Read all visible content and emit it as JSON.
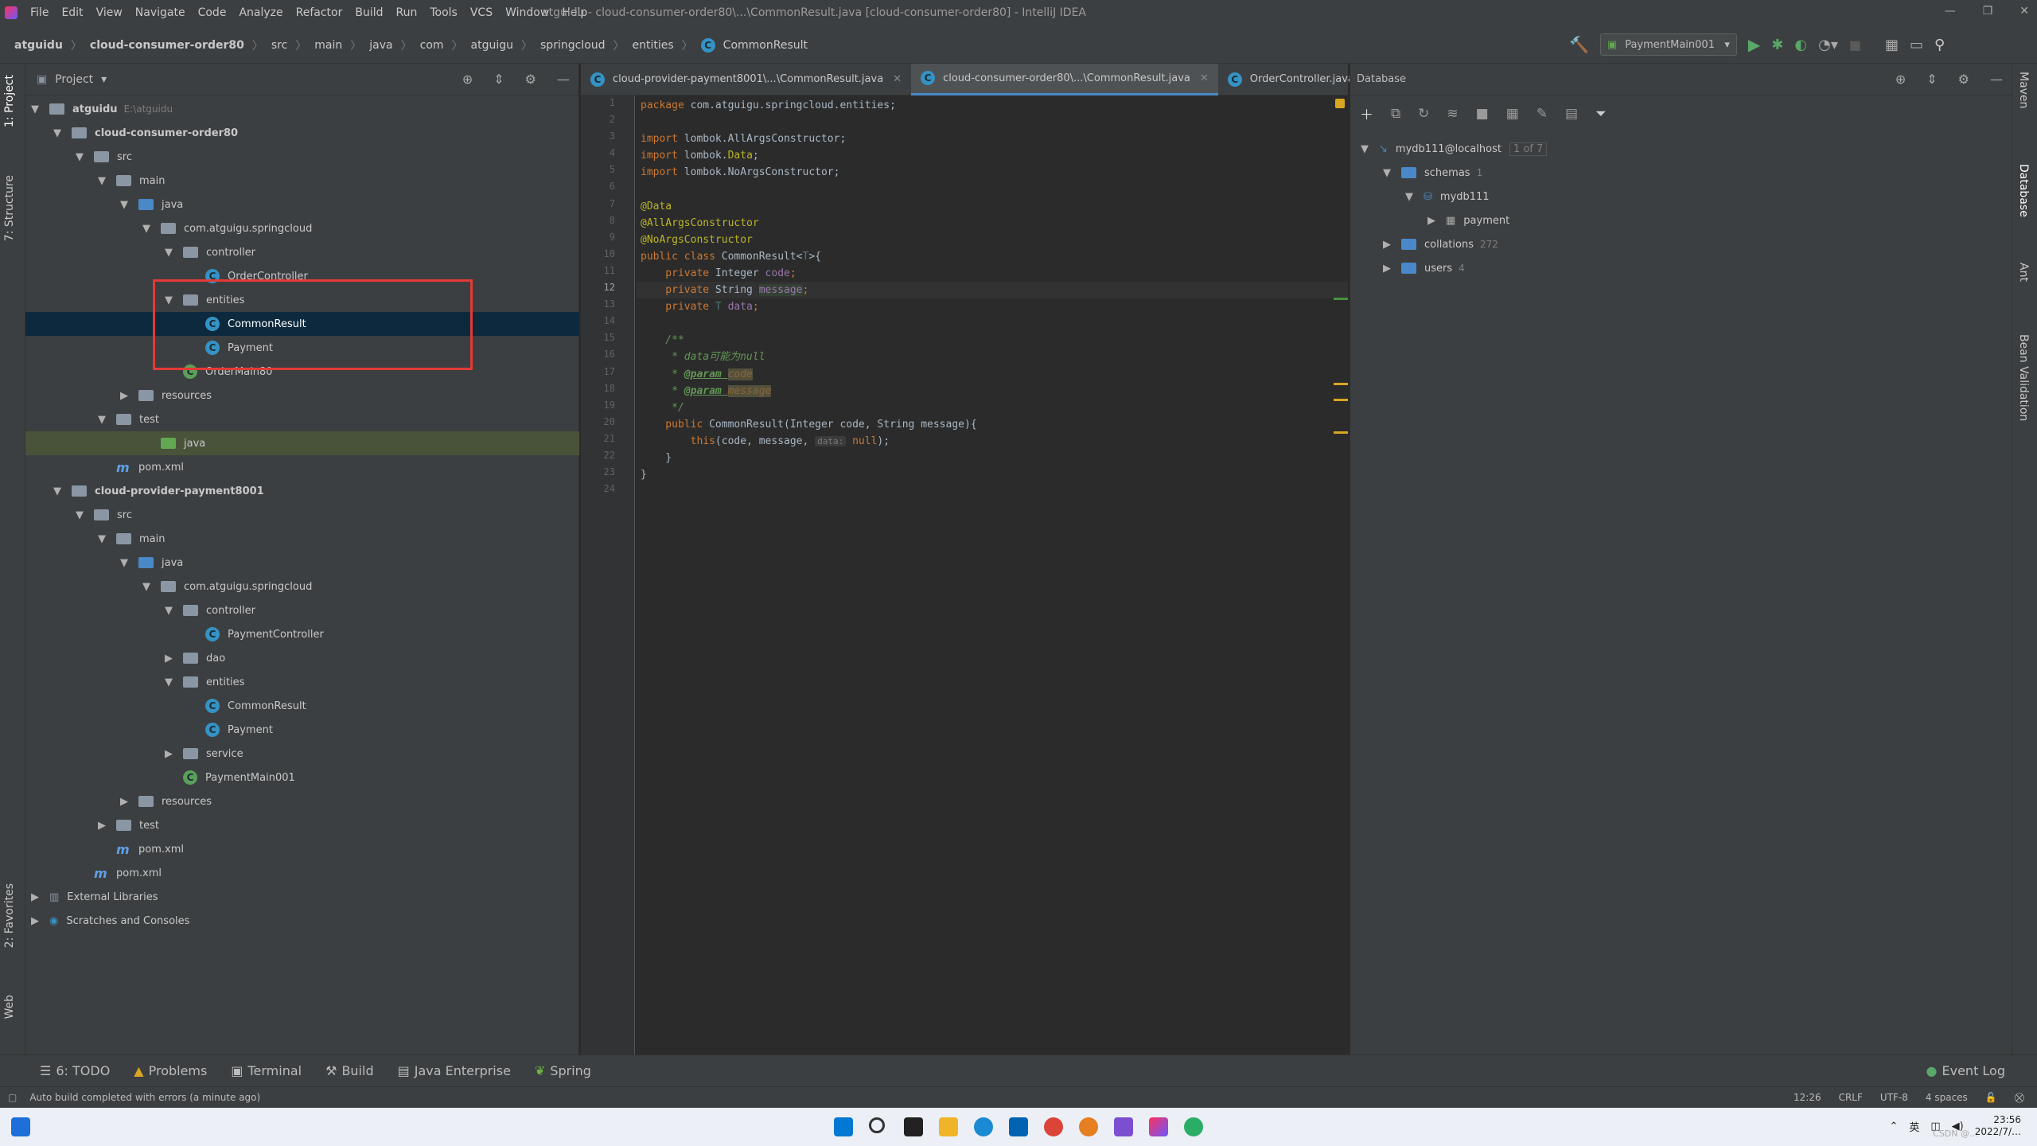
{
  "window": {
    "menu": [
      "File",
      "Edit",
      "View",
      "Navigate",
      "Code",
      "Analyze",
      "Refactor",
      "Build",
      "Run",
      "Tools",
      "VCS",
      "Window",
      "Help"
    ],
    "title": "atguidu - cloud-consumer-order80\\...\\CommonResult.java [cloud-consumer-order80] - IntelliJ IDEA"
  },
  "breadcrumbs": [
    "atguidu",
    "cloud-consumer-order80",
    "src",
    "main",
    "java",
    "com",
    "atguigu",
    "springcloud",
    "entities",
    "CommonResult"
  ],
  "run_config": "PaymentMain001",
  "left_tabs": [
    "1: Project",
    "7: Structure",
    "2: Favorites",
    "Web"
  ],
  "right_tabs": [
    "Maven",
    "Database",
    "Ant",
    "Bean Validation"
  ],
  "project": {
    "header": "Project",
    "items": [
      {
        "label": "atguidu",
        "extra": "E:\\atguidu"
      },
      {
        "label": "cloud-consumer-order80"
      },
      {
        "label": "src"
      },
      {
        "label": "main"
      },
      {
        "label": "java"
      },
      {
        "label": "com.atguigu.springcloud"
      },
      {
        "label": "controller"
      },
      {
        "label": "OrderController"
      },
      {
        "label": "entities"
      },
      {
        "label": "CommonResult"
      },
      {
        "label": "Payment"
      },
      {
        "label": "OrderMain80"
      },
      {
        "label": "resources"
      },
      {
        "label": "test"
      },
      {
        "label": "java"
      },
      {
        "label": "pom.xml"
      },
      {
        "label": "cloud-provider-payment8001"
      },
      {
        "label": "src"
      },
      {
        "label": "main"
      },
      {
        "label": "java"
      },
      {
        "label": "com.atguigu.springcloud"
      },
      {
        "label": "controller"
      },
      {
        "label": "PaymentController"
      },
      {
        "label": "dao"
      },
      {
        "label": "entities"
      },
      {
        "label": "CommonResult"
      },
      {
        "label": "Payment"
      },
      {
        "label": "service"
      },
      {
        "label": "PaymentMain001"
      },
      {
        "label": "resources"
      },
      {
        "label": "test"
      },
      {
        "label": "pom.xml"
      },
      {
        "label": "pom.xml"
      },
      {
        "label": "External Libraries"
      },
      {
        "label": "Scratches and Consoles"
      }
    ]
  },
  "editor": {
    "tabs": [
      {
        "label": "cloud-provider-payment8001\\...\\CommonResult.java"
      },
      {
        "label": "cloud-consumer-order80\\...\\CommonResult.java"
      },
      {
        "label": "OrderController.java"
      }
    ],
    "line_numbers": [
      "1",
      "2",
      "3",
      "4",
      "5",
      "6",
      "7",
      "8",
      "9",
      "10",
      "11",
      "12",
      "13",
      "14",
      "15",
      "16",
      "17",
      "18",
      "19",
      "20",
      "21",
      "22",
      "23",
      "24"
    ],
    "code": {
      "l1a": "package ",
      "l1b": "com.atguigu.springcloud.entities;",
      "l3a": "import ",
      "l3b": "lombok.AllArgsConstructor;",
      "l4a": "import ",
      "l4b": "lombok.",
      "l4c": "Data",
      ";": ";",
      "l5a": "import ",
      "l5b": "lombok.NoArgsConstructor;",
      "l7": "@Data",
      "l8": "@AllArgsConstructor",
      "l9": "@NoArgsConstructor",
      "l10a": "public class ",
      "l10b": "CommonResult<",
      "l10c": "T",
      "l10d": ">{",
      "l11a": "    private ",
      "l11b": "Integer ",
      "l11c": "code",
      "l12a": "    private ",
      "l12b": "String ",
      "l12c": "message",
      "l13a": "    private ",
      "l13b": "T ",
      "l13c": "data",
      "l15": "    /**",
      "l16": "     * data可能为null",
      "l17a": "     * ",
      "l17b": "@param ",
      "l17c": "code",
      "l18a": "     * ",
      "l18b": "@param ",
      "l18c": "message",
      "l19": "     */",
      "l20a": "    public ",
      "l20b": "CommonResult(Integer code, String message){",
      "l21a": "        this",
      "l21b": "(code, message, ",
      "l21c": "data:",
      "l21d": " null",
      ");": ");",
      "l22": "    }",
      "l23": "}"
    }
  },
  "database": {
    "header": "Database",
    "connection": "mydb111@localhost",
    "connection_badge": "1 of 7",
    "schemas_label": "schemas",
    "schemas_count": "1",
    "schema_name": "mydb111",
    "table_name": "payment",
    "collations_label": "collations",
    "collations_count": "272",
    "users_label": "users",
    "users_count": "4"
  },
  "bottom_tools": [
    "6: TODO",
    "Problems",
    "Terminal",
    "Build",
    "Java Enterprise",
    "Spring"
  ],
  "event_log": "Event Log",
  "status": {
    "message": "Auto build completed with errors (a minute ago)",
    "position": "12:26",
    "line_sep": "CRLF",
    "encoding": "UTF-8",
    "indent": "4 spaces"
  },
  "taskbar": {
    "lang": "英",
    "time": "23:56",
    "date": "2022/7/…",
    "watermark": "CSDN @…"
  },
  "colors": {
    "accent": "#4a88c7",
    "selection": "#0d293e",
    "highlight_box": "#e53935"
  }
}
